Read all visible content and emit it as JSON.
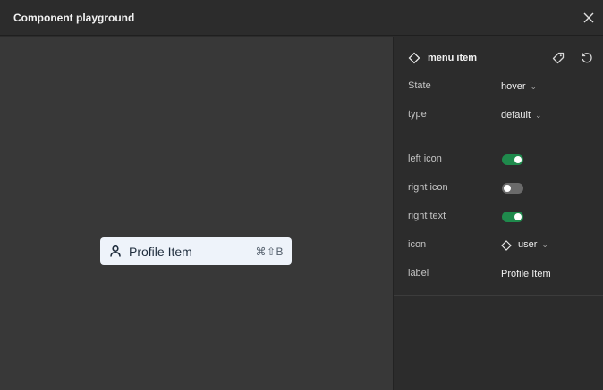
{
  "window": {
    "title": "Component playground"
  },
  "preview": {
    "item_label": "Profile Item",
    "shortcut": "⌘⇧B",
    "left_icon": "user-icon"
  },
  "panel": {
    "title": "menu item",
    "title_icon": "diamond-icon",
    "actions": [
      "tag-icon",
      "reset-icon"
    ],
    "props": {
      "state": {
        "label": "State",
        "value": "hover"
      },
      "type": {
        "label": "type",
        "value": "default"
      },
      "left_icon": {
        "label": "left icon",
        "on": true
      },
      "right_icon": {
        "label": "right icon",
        "on": false
      },
      "right_text": {
        "label": "right text",
        "on": true
      },
      "icon": {
        "label": "icon",
        "value": "user"
      },
      "label": {
        "label": "label",
        "value": "Profile Item"
      }
    }
  },
  "colors": {
    "toggle_on": "#1f8a4c",
    "toggle_off": "#6a6a6a",
    "canvas": "#383838",
    "panel": "#2c2c2c",
    "menu_item_bg": "#eef3fa"
  }
}
